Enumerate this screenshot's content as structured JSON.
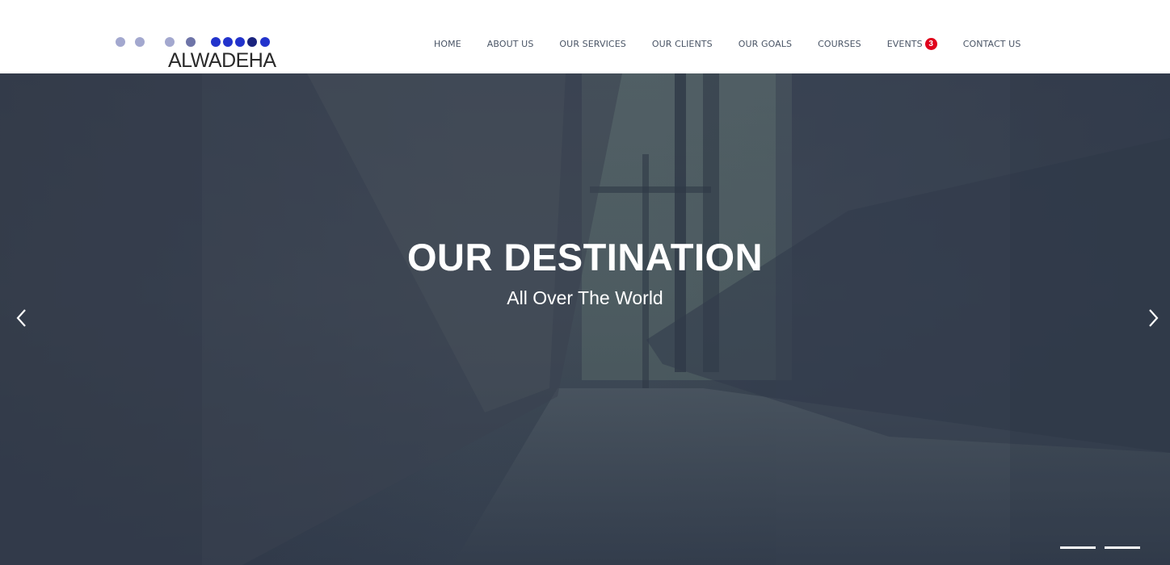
{
  "logo": {
    "text": "ALWADEHA",
    "dot_colors": [
      "#a3a8cf",
      "#a3a8cf",
      "#a3a8cf",
      "#6e74a8",
      "#2233cc",
      "#2233cc",
      "#2233cc",
      "#1a237e",
      "#2233cc"
    ]
  },
  "nav": {
    "items": [
      {
        "label": "HOME"
      },
      {
        "label": "ABOUT US"
      },
      {
        "label": "OUR SERVICES"
      },
      {
        "label": "OUR CLIENTS"
      },
      {
        "label": "OUR GOALS"
      },
      {
        "label": "COURSES"
      },
      {
        "label": "EVENTS",
        "badge": "3"
      },
      {
        "label": "CONTACT US"
      }
    ]
  },
  "hero": {
    "title": "OUR DESTINATION",
    "subtitle": "All Over The World",
    "prev_icon": "chevron-left-icon",
    "next_icon": "chevron-right-icon",
    "slide_count": 2
  },
  "colors": {
    "nav_text": "#4a5566",
    "badge": "#e0001b",
    "hero_overlay": "#3b4554"
  }
}
